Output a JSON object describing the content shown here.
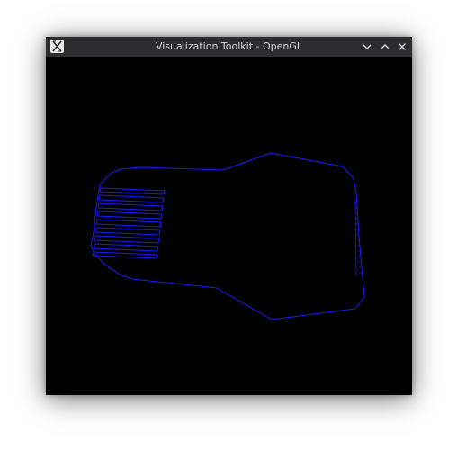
{
  "window": {
    "title": "Visualization Toolkit - OpenGL",
    "app_icon": "x-window-icon",
    "controls": {
      "minimize_icon": "chevron-down-icon",
      "maximize_icon": "chevron-up-icon",
      "close_icon": "close-icon"
    }
  },
  "colors": {
    "titlebar": "#2b2d30",
    "title_text": "#d6d7d9",
    "viewport_background": "#000000",
    "outline": "#1a1aff"
  }
}
